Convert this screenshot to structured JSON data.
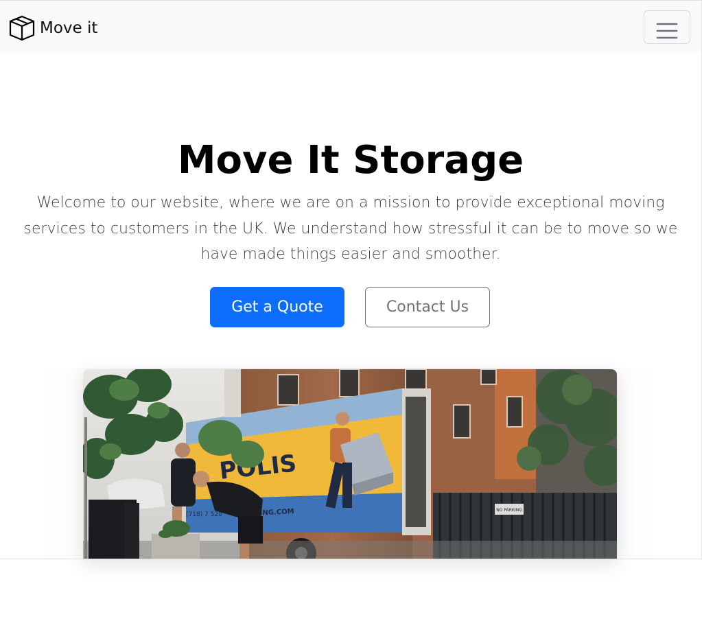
{
  "brand": {
    "name": "Move it",
    "icon": "box-icon"
  },
  "nav": {
    "toggle_icon": "hamburger-icon"
  },
  "hero": {
    "title": "Move It Storage",
    "lead": "Welcome to our website, where we are on a mission to provide exceptional moving services to customers in the UK. We understand how stressful it can be to move so we have made things easier and smoother.",
    "primary_button": "Get a Quote",
    "secondary_button": "Contact Us"
  },
  "photo": {
    "truck_text_brand": "POLIS",
    "truck_text_web": "MOVING.COM",
    "truck_text_phone": "(718) 7 520",
    "sign_text": "NO PARKING"
  },
  "colors": {
    "primary": "#0d6efd",
    "secondary": "#6c757d",
    "navbar_bg": "#f8f9fa"
  }
}
